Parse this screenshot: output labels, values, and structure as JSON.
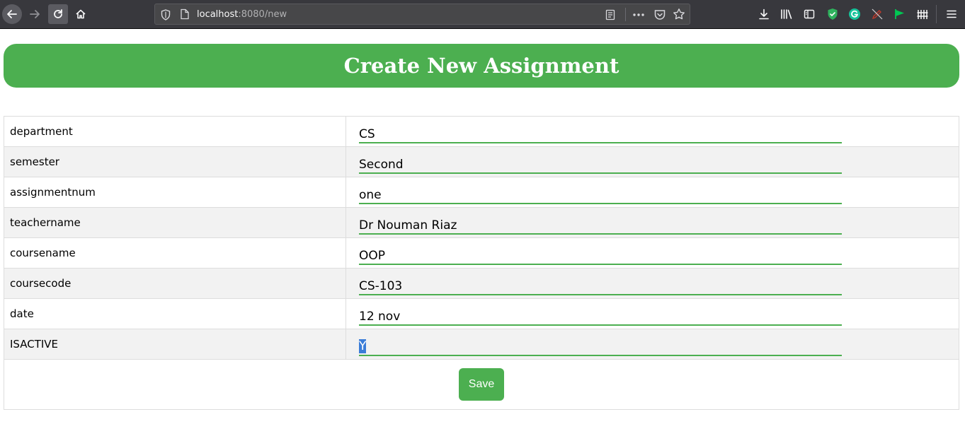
{
  "browser": {
    "url_host": "localhost",
    "url_rest": ":8080/new",
    "icons": [
      "back-arrow-icon",
      "forward-arrow-icon",
      "reload-icon",
      "home-icon",
      "shield-icon",
      "page-icon",
      "reader-view-icon",
      "more-icon",
      "pocket-icon",
      "star-icon",
      "download-icon",
      "library-icon",
      "sidebar-icon",
      "shield-extension-icon",
      "grammarly-icon",
      "pen-off-icon",
      "flag-icon",
      "fence-icon",
      "hamburger-menu-icon"
    ]
  },
  "page": {
    "title": "Create New Assignment",
    "accent_color": "#4caf50"
  },
  "form": {
    "fields": [
      {
        "label": "department",
        "value": "CS"
      },
      {
        "label": "semester",
        "value": "Second"
      },
      {
        "label": "assignmentnum",
        "value": "one"
      },
      {
        "label": "teachername",
        "value": "Dr Nouman Riaz"
      },
      {
        "label": "coursename",
        "value": "OOP"
      },
      {
        "label": "coursecode",
        "value": "CS-103"
      },
      {
        "label": "date",
        "value": "12 nov"
      },
      {
        "label": "ISACTIVE",
        "value": "Y"
      }
    ],
    "save_label": "Save"
  }
}
